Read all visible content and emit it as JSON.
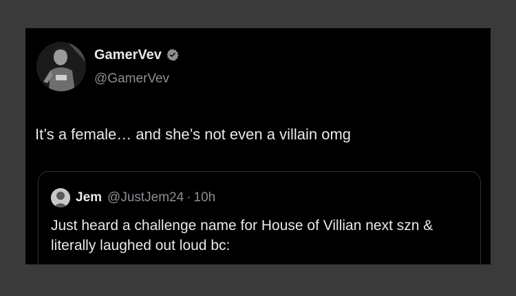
{
  "tweet": {
    "author": {
      "display_name": "GamerVev",
      "handle": "@GamerVev",
      "verified_icon": "verified-badge-icon",
      "avatar_icon": "profile-avatar"
    },
    "text": "It’s a female… and she’s not even a villain omg"
  },
  "quoted_tweet": {
    "author": {
      "display_name": "Jem",
      "handle": "@JustJem24",
      "separator": "·",
      "time": "10h",
      "avatar_icon": "profile-avatar"
    },
    "text": "Just heard a challenge name for House of Villian next szn & literally laughed out loud bc:"
  },
  "colors": {
    "background": "#000000",
    "outer_frame": "#3a3a3a",
    "primary_text": "#e7e9ea",
    "secondary_text": "#8b8f93",
    "border": "#2f3336"
  }
}
